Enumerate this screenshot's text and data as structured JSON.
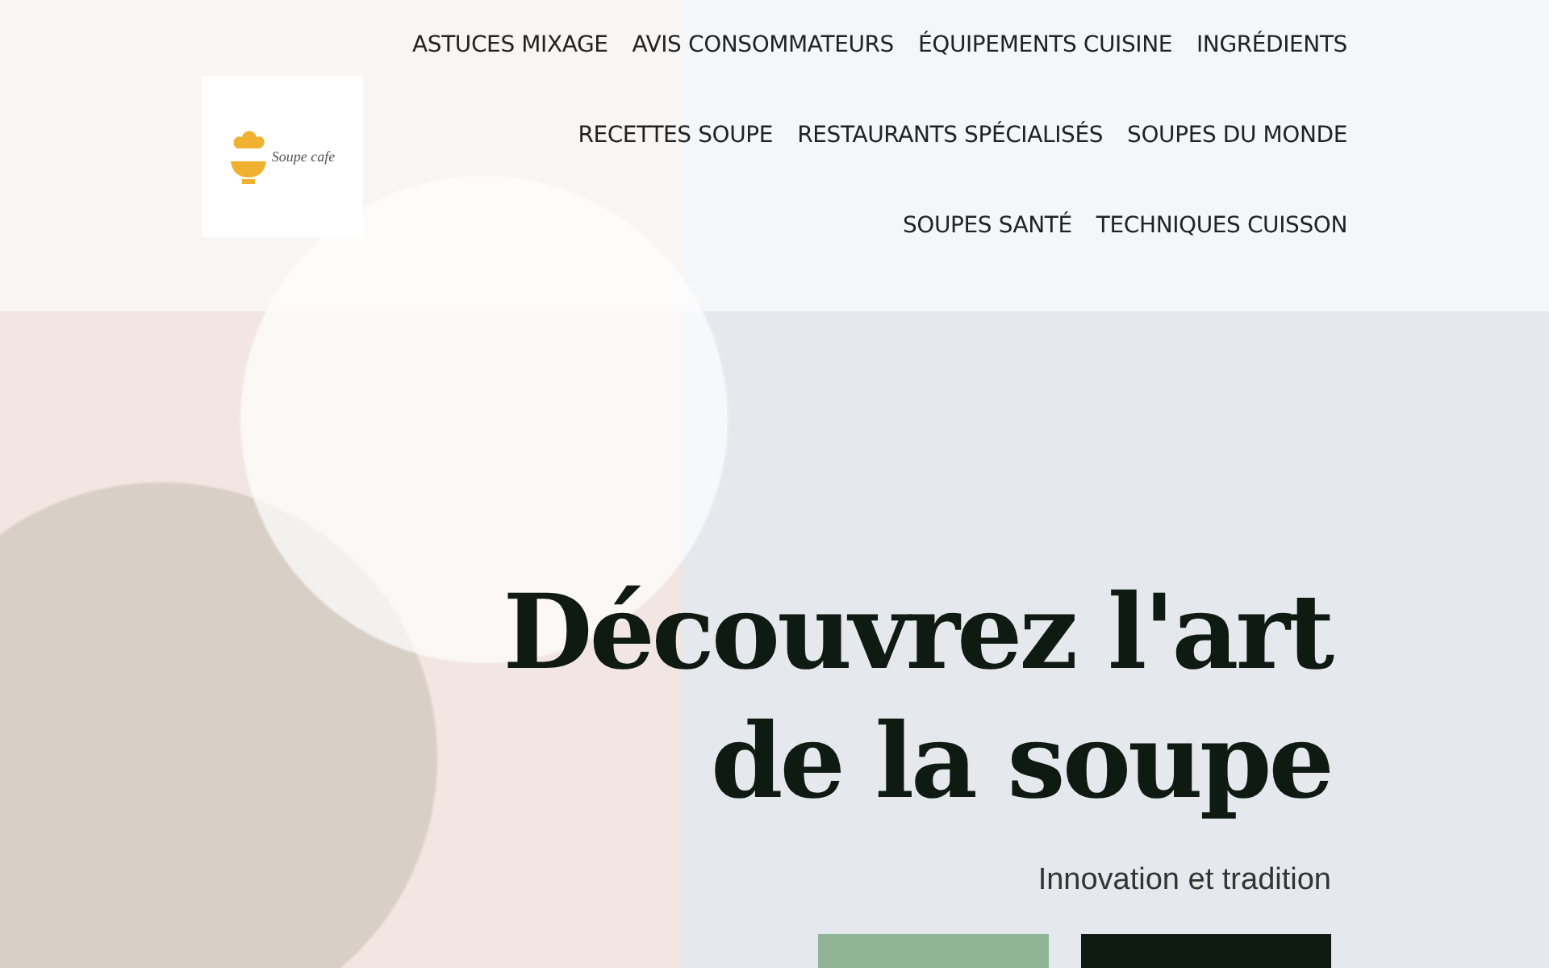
{
  "logo": {
    "text": "Soupe cafe"
  },
  "nav": {
    "items": [
      "ASTUCES MIXAGE",
      "AVIS CONSOMMATEURS",
      "ÉQUIPEMENTS CUISINE",
      "INGRÉDIENTS",
      "RECETTES SOUPE",
      "RESTAURANTS SPÉCIALISÉS",
      "SOUPES DU MONDE",
      "SOUPES SANTÉ",
      "TECHNIQUES CUISSON"
    ]
  },
  "hero": {
    "title_lines": [
      "Découvrez l'art",
      "de la soupe"
    ],
    "subtitle": "Innovation et tradition",
    "buttons": [
      {
        "kind": "secondary"
      },
      {
        "kind": "primary"
      }
    ]
  }
}
